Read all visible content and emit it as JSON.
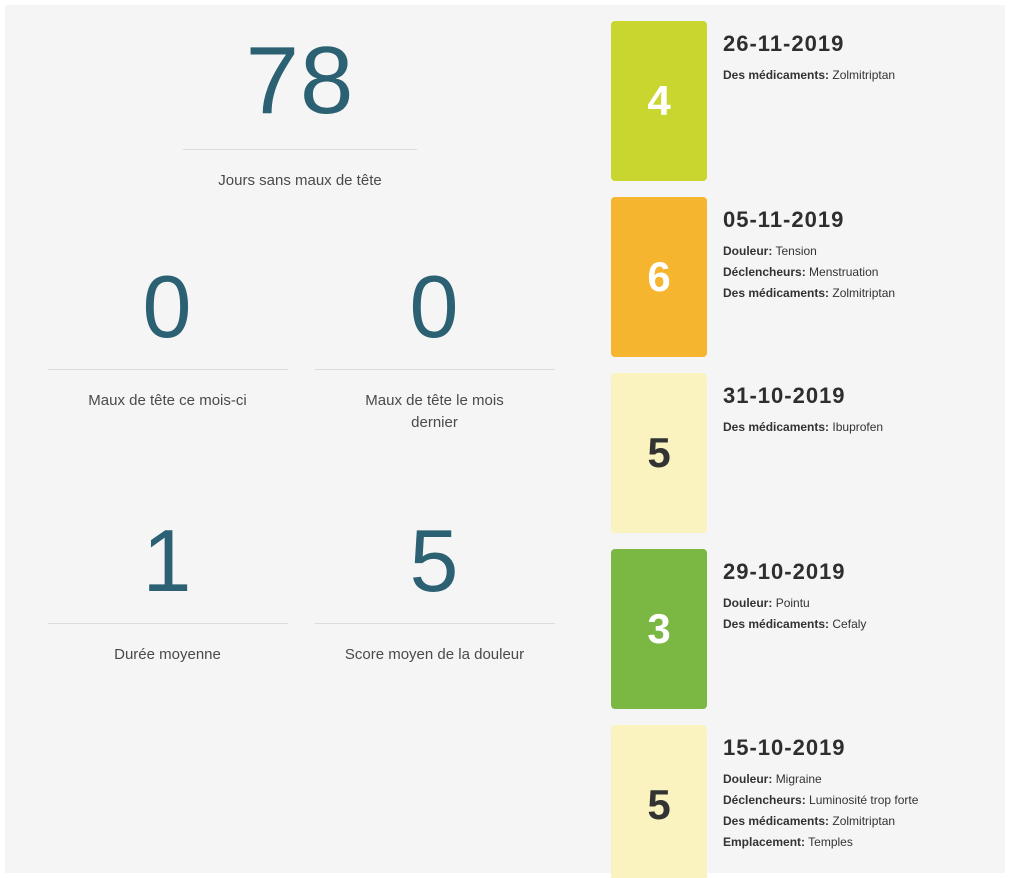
{
  "stats": {
    "days_without": {
      "value": "78",
      "label": "Jours sans maux de tête"
    },
    "this_month": {
      "value": "0",
      "label": "Maux de tête ce mois-ci"
    },
    "last_month": {
      "value": "0",
      "label": "Maux de tête le mois dernier"
    },
    "avg_duration": {
      "value": "1",
      "label": "Durée moyenne"
    },
    "avg_score": {
      "value": "5",
      "label": "Score moyen de la douleur"
    }
  },
  "entries": [
    {
      "score": "4",
      "color": "#c9d62f",
      "text_color": "#ffffff",
      "date": "26-11-2019",
      "details": [
        {
          "key": "Des médicaments:",
          "value": "Zolmitriptan"
        }
      ]
    },
    {
      "score": "6",
      "color": "#f5b52f",
      "text_color": "#ffffff",
      "date": "05-11-2019",
      "details": [
        {
          "key": "Douleur:",
          "value": "Tension"
        },
        {
          "key": "Déclencheurs:",
          "value": "Menstruation"
        },
        {
          "key": "Des médicaments:",
          "value": "Zolmitriptan"
        }
      ]
    },
    {
      "score": "5",
      "color": "#fbf3bf",
      "text_color": "#333333",
      "date": "31-10-2019",
      "details": [
        {
          "key": "Des médicaments:",
          "value": "Ibuprofen"
        }
      ]
    },
    {
      "score": "3",
      "color": "#7ab843",
      "text_color": "#ffffff",
      "date": "29-10-2019",
      "details": [
        {
          "key": "Douleur:",
          "value": "Pointu"
        },
        {
          "key": "Des médicaments:",
          "value": "Cefaly"
        }
      ]
    },
    {
      "score": "5",
      "color": "#fbf3bf",
      "text_color": "#333333",
      "date": "15-10-2019",
      "details": [
        {
          "key": "Douleur:",
          "value": "Migraine"
        },
        {
          "key": "Déclencheurs:",
          "value": "Luminosité trop forte"
        },
        {
          "key": "Des médicaments:",
          "value": "Zolmitriptan"
        },
        {
          "key": "Emplacement:",
          "value": "Temples"
        }
      ]
    }
  ]
}
